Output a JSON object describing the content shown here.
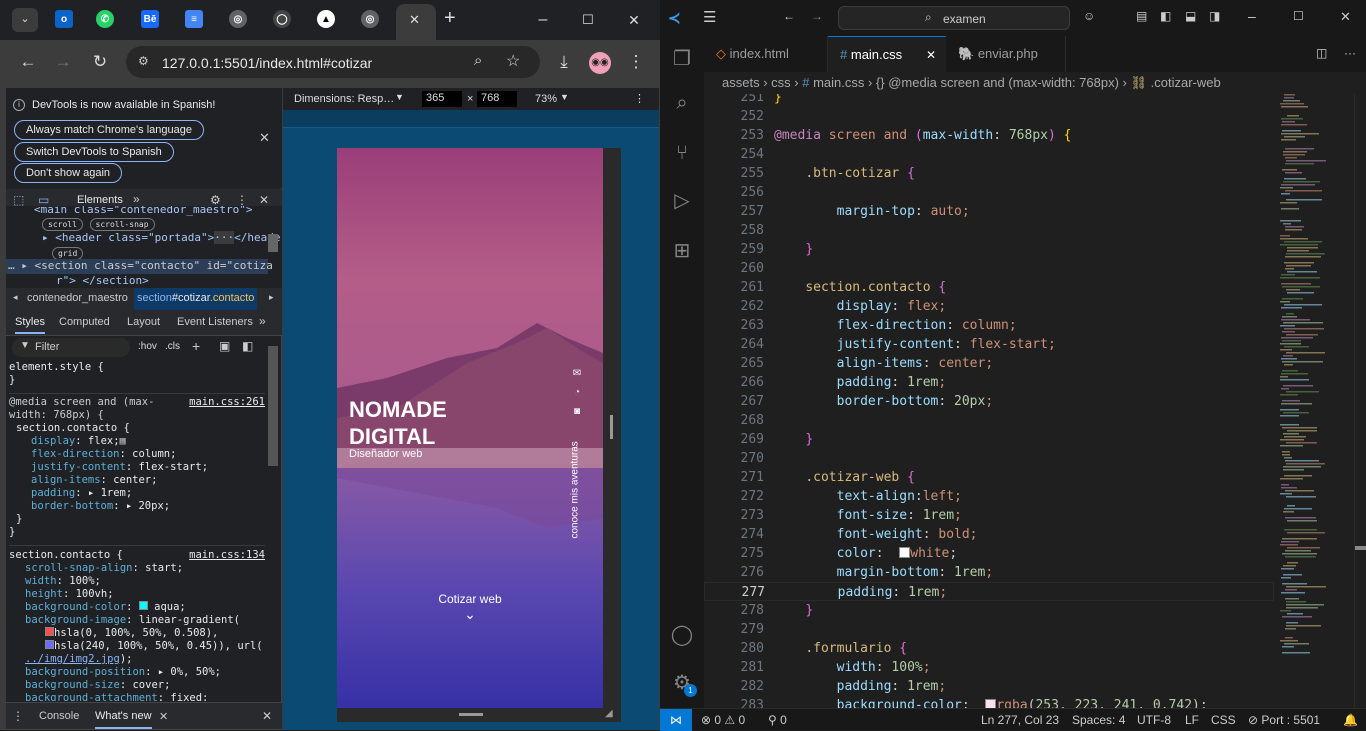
{
  "browser": {
    "tabs": [
      "outlook-icon",
      "whatsapp-icon",
      "behance-icon",
      "docs-icon",
      "globe-icon",
      "github-icon",
      "vercel-icon",
      "globe-icon"
    ],
    "new_tab": "+",
    "url": "127.0.0.1:5501/index.html#cotizar",
    "window": {
      "minimize": "–",
      "maximize": "☐",
      "close": "✕"
    }
  },
  "devtools": {
    "notice": "DevTools is now available in Spanish!",
    "btn_lang": "Always match Chrome's language",
    "btn_switch": "Switch DevTools to Spanish",
    "btn_dont": "Don't show again",
    "tab_elements": "Elements",
    "dom": {
      "l1": "<main class=\"contenedor_maestro\">",
      "badge_scroll": "scroll",
      "badge_snap": "scroll-snap",
      "l2a": "<header class=\"portada\">",
      "l2b": "</header>",
      "badge_grid": "grid",
      "l3": "<section class=\"contacto\" id=\"cotiza",
      "l4": "r\"> </section>"
    },
    "crumb1": "contenedor_maestro",
    "crumb2a": "section",
    "crumb2b": "#cotizar",
    "crumb2c": ".contacto",
    "subtabs": {
      "styles": "Styles",
      "computed": "Computed",
      "layout": "Layout",
      "events": "Event Listeners"
    },
    "filter": "Filter",
    "hov": ":hov",
    "cls": ".cls",
    "drawer": {
      "console": "Console",
      "whatsnew": "What's new"
    }
  },
  "styles": {
    "element": "element.style {",
    "element_end": "}",
    "media1": "@media screen and (max-",
    "media2": "width: 768px) {",
    "link1": "main.css:261",
    "sel1": "section.contacto {",
    "p1": "display",
    "v1": "flex;",
    "p2": "flex-direction",
    "v2": "column;",
    "p3": "justify-content",
    "v3": "flex-start;",
    "p4": "align-items",
    "v4": "center;",
    "p5": "padding",
    "v5": "1rem;",
    "p6": "border-bottom",
    "v6": "20px;",
    "close": "}",
    "sel2": "section.contacto {",
    "link2": "main.css:134",
    "q1": "scroll-snap-align",
    "w1": "start;",
    "q2": "width",
    "w2": "100%;",
    "q3": "height",
    "w3": "100vh;",
    "q4": "background-color",
    "w4": "aqua;",
    "q5": "background-image",
    "w5": "linear-gradient(",
    "w5b": "hsla(0, 100%, 50%, 0.508),",
    "w5c": "hsla(240, 100%, 50%, 0.45)), url(",
    "w5d": "../img/img2.jpg",
    "w5e": ");",
    "q6": "background-position",
    "w6": "0%, 50%;",
    "q7": "background-size",
    "w7": "cover;",
    "q8": "background-attachment",
    "w8": "fixed;"
  },
  "emulation": {
    "dimensions": "Dimensions: Resp…",
    "width": "365",
    "times": "×",
    "height": "768",
    "zoom": "73%"
  },
  "site": {
    "title1": "NOMADE",
    "title2": "DIGITAL",
    "subtitle": "Diseñador web",
    "vertical": "conoce mis aventuras",
    "cta": "Cotizar web",
    "chevron": "⌄"
  },
  "vscode": {
    "search": "examen",
    "tabs": [
      "index.html",
      "main.css",
      "enviar.php"
    ],
    "crumbs": {
      "a": "assets",
      "b": "css",
      "c": "main.css",
      "d": "@media screen and (max-width: 768px)",
      "e": ".cotizar-web"
    },
    "status": {
      "errors": "0",
      "warnings": "0",
      "ports": "0",
      "position": "Ln 277, Col 23",
      "spaces": "Spaces: 4",
      "encoding": "UTF-8",
      "eol": "LF",
      "lang": "CSS",
      "port": "Port : 5501"
    },
    "badge": "1"
  },
  "code": [
    {
      "n": "251",
      "t": "}"
    },
    {
      "n": "252",
      "t": ""
    },
    {
      "n": "253",
      "t": "@media screen and (max-width: 768px) {"
    },
    {
      "n": "254",
      "t": ""
    },
    {
      "n": "255",
      "t": "    .btn-cotizar {"
    },
    {
      "n": "256",
      "t": ""
    },
    {
      "n": "257",
      "t": "        margin-top: auto;"
    },
    {
      "n": "258",
      "t": ""
    },
    {
      "n": "259",
      "t": "    }"
    },
    {
      "n": "260",
      "t": ""
    },
    {
      "n": "261",
      "t": "    section.contacto {"
    },
    {
      "n": "262",
      "t": "        display: flex;"
    },
    {
      "n": "263",
      "t": "        flex-direction: column;"
    },
    {
      "n": "264",
      "t": "        justify-content: flex-start;"
    },
    {
      "n": "265",
      "t": "        align-items: center;"
    },
    {
      "n": "266",
      "t": "        padding: 1rem;"
    },
    {
      "n": "267",
      "t": "        border-bottom: 20px;"
    },
    {
      "n": "268",
      "t": ""
    },
    {
      "n": "269",
      "t": "    }"
    },
    {
      "n": "270",
      "t": ""
    },
    {
      "n": "271",
      "t": "    .cotizar-web {"
    },
    {
      "n": "272",
      "t": "        text-align:left;"
    },
    {
      "n": "273",
      "t": "        font-size: 1rem;"
    },
    {
      "n": "274",
      "t": "        font-weight: bold;"
    },
    {
      "n": "275",
      "t": "        color:  white;"
    },
    {
      "n": "276",
      "t": "        margin-bottom: 1rem;"
    },
    {
      "n": "277",
      "t": "        padding: 1rem;"
    },
    {
      "n": "278",
      "t": "    }"
    },
    {
      "n": "279",
      "t": ""
    },
    {
      "n": "280",
      "t": "    .formulario {"
    },
    {
      "n": "281",
      "t": "        width: 100%;"
    },
    {
      "n": "282",
      "t": "        padding: 1rem;"
    },
    {
      "n": "283",
      "t": "        background-color:  rgba(253, 223, 241, 0.742);"
    }
  ],
  "colors": {
    "accent": "#0078d4",
    "dtblue": "#8ab4f8",
    "swatch_aqua": "#00ffff",
    "swatch_red": "#ff4d4d",
    "swatch_blue": "#6b6bff",
    "swatch_pink": "#fddff1"
  }
}
